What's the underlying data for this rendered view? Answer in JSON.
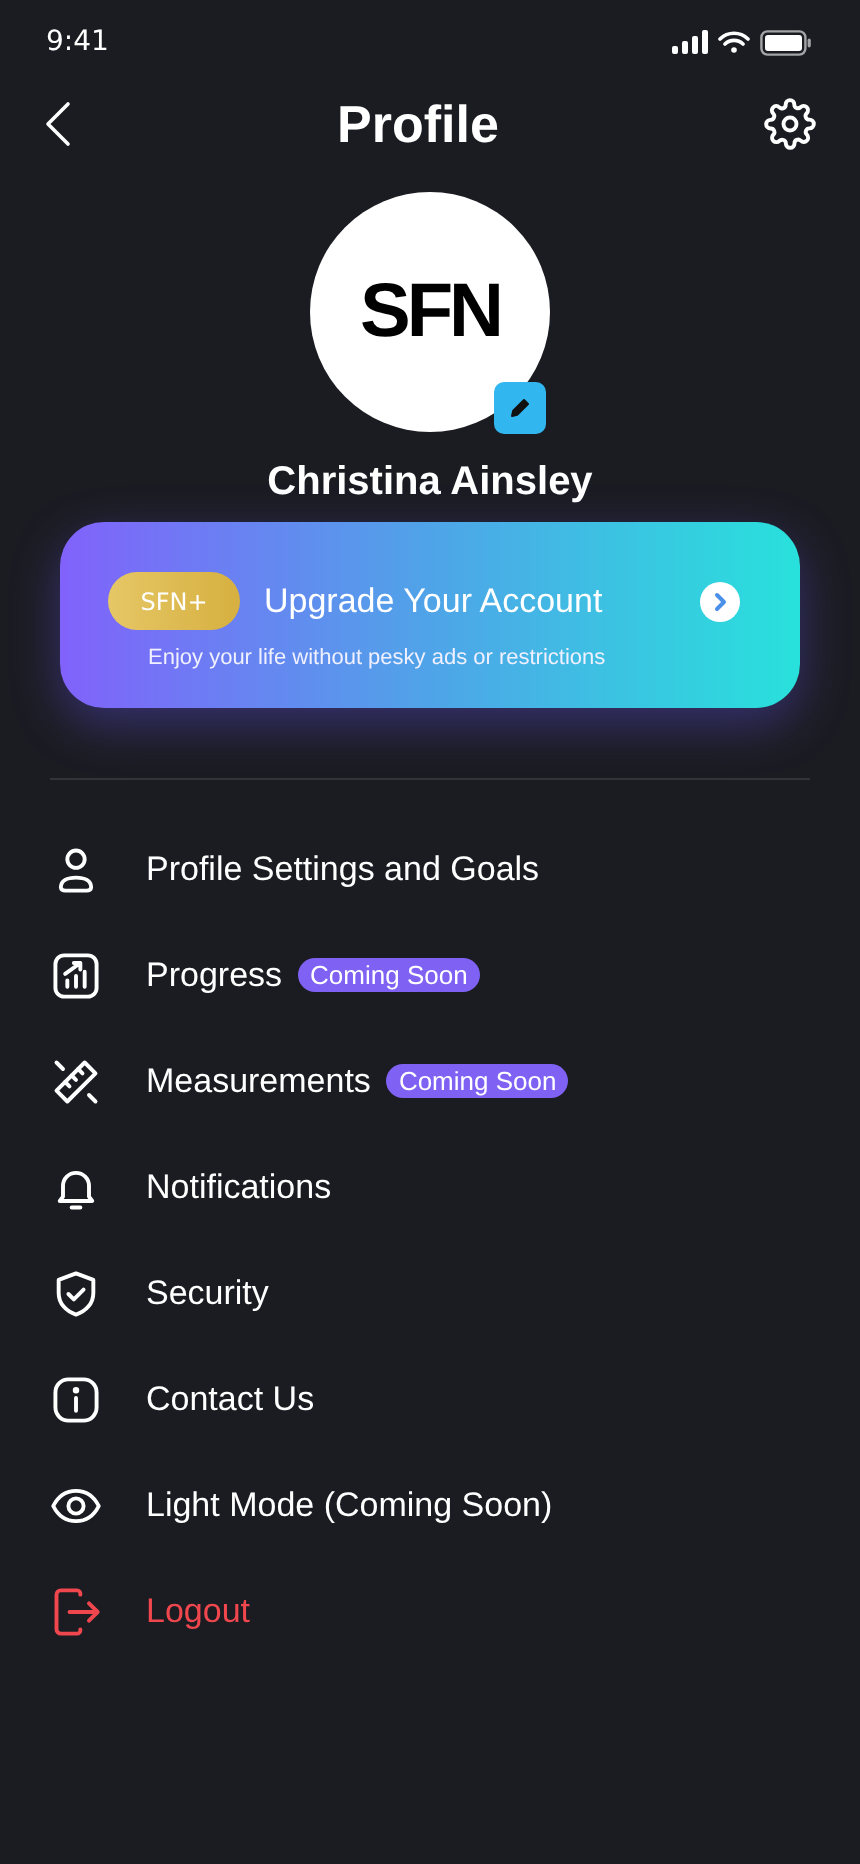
{
  "status_bar": {
    "time": "9:41"
  },
  "header": {
    "title": "Profile"
  },
  "profile": {
    "logo": "SFN",
    "name": "Christina Ainsley"
  },
  "upgrade": {
    "tag": "SFN+",
    "title": "Upgrade Your Account",
    "subtitle": "Enjoy your life without pesky ads or restrictions"
  },
  "menu": [
    {
      "label": "Profile Settings and Goals",
      "kind": "normal"
    },
    {
      "label": "Progress",
      "kind": "normal",
      "badge": "Coming Soon"
    },
    {
      "label": "Measurements",
      "kind": "normal",
      "badge": "Coming Soon"
    },
    {
      "label": "Notifications",
      "kind": "normal"
    },
    {
      "label": "Security",
      "kind": "normal"
    },
    {
      "label": "Contact Us",
      "kind": "normal"
    },
    {
      "label": "Light Mode (Coming Soon)",
      "kind": "normal"
    },
    {
      "label": "Logout",
      "kind": "danger"
    }
  ]
}
